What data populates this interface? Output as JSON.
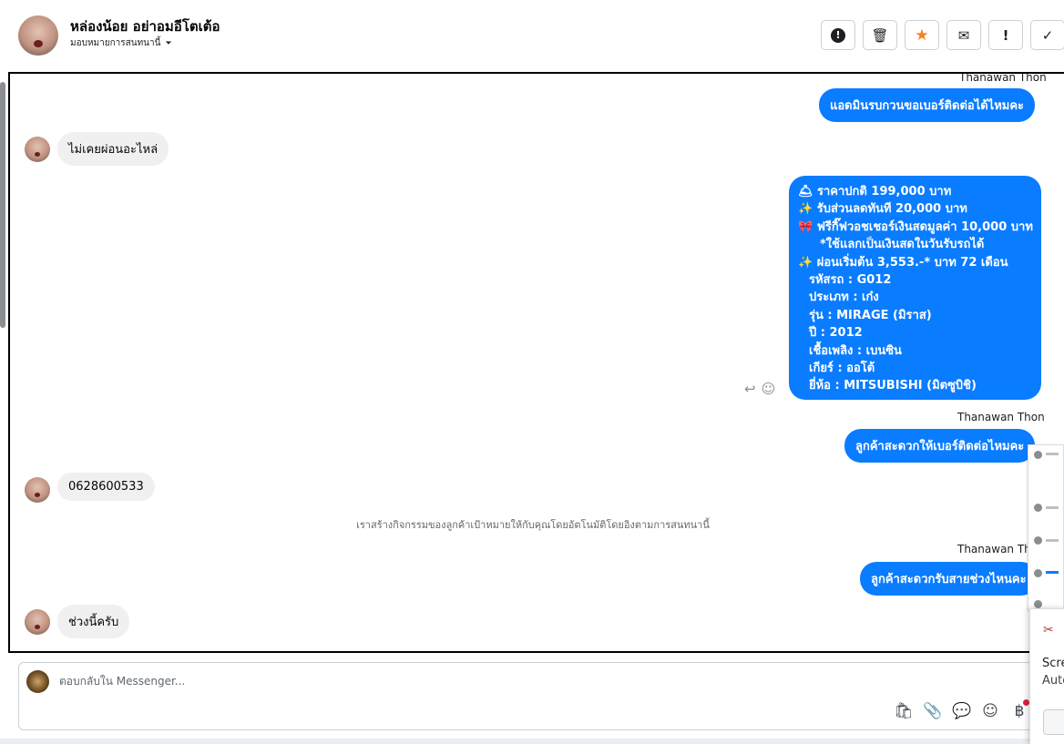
{
  "header": {
    "contact_name": "หล่องน้อย อย่าอมอีโตเต้อ",
    "assign_label": "มอบหมายการสนทนานี้",
    "assign_caret": "⏷",
    "toolbar": [
      {
        "name": "spam",
        "icon": "!"
      },
      {
        "name": "trash",
        "icon": "🗑"
      },
      {
        "name": "star",
        "icon": "★"
      },
      {
        "name": "mark-unread",
        "icon": "✉"
      },
      {
        "name": "follow-up",
        "icon": "!"
      },
      {
        "name": "done",
        "icon": "✓"
      }
    ]
  },
  "messages": {
    "sender_1": "Thanawan Thon",
    "out_1": "แอดมินรบกวนขอเบอร์ติดต่อได้ไหมคะ",
    "in_1": "ไม่เคยผ่อนอะไหล่",
    "offer": {
      "line1": "🛎 ราคาปกติ 199,000 บาท",
      "line2": "✨ รับส่วนลดทันที 20,000 บาท",
      "line3": "🎀 ฟรีกิ๊ฟวอชเชอร์เงินสดมูลค่า 10,000 บาท",
      "line4": "*ใช้แลกเป็นเงินสดในวันรับรถได้",
      "line5": "✨ ผ่อนเริ่มต้น 3,553.-* บาท 72 เดือน",
      "line6": "รหัสรถ : G012",
      "line7": "ประเภท : เก๋ง",
      "line8": "รุ่น : MIRAGE (มิราส)",
      "line9": "ปี : 2012",
      "line10": "เชื้อเพลิง : เบนซิน",
      "line11": "เกียร์ : ออโต้",
      "line12": "ยี่ห้อ : MITSUBISHI (มิตซูบิชิ)"
    },
    "reply_icon": "↩",
    "react_icon": "☺",
    "sender_2": "Thanawan Thon",
    "out_2": "ลูกค้าสะดวกให้เบอร์ติดต่อไหมคะ",
    "in_2": "0628600533",
    "system_note": "เราสร้างกิจกรรมของลูกค้าเป้าหมายให้กับคุณโดยอัตโนมัติโดยอิงตามการสนทนานี้",
    "sender_3": "Thanawan Thon",
    "out_3": "ลูกค้าสะดวกรับสายช่วงไหนคะ",
    "in_3": "ช่วงนี้ครับ"
  },
  "reply": {
    "placeholder": "ตอบกลับใน Messenger...",
    "icons": [
      {
        "name": "shop",
        "glyph": "🛍"
      },
      {
        "name": "attach",
        "glyph": "📎"
      },
      {
        "name": "saved-reply",
        "glyph": "💬"
      },
      {
        "name": "emoji",
        "glyph": "☺"
      },
      {
        "name": "payment",
        "glyph": "฿"
      }
    ]
  },
  "overlay": {
    "popup_line1": "Scre",
    "popup_line2": "Auto"
  },
  "colors": {
    "bubble_out": "#0a7cff",
    "bubble_in": "#f0f0f0",
    "star": "#f5821f"
  }
}
